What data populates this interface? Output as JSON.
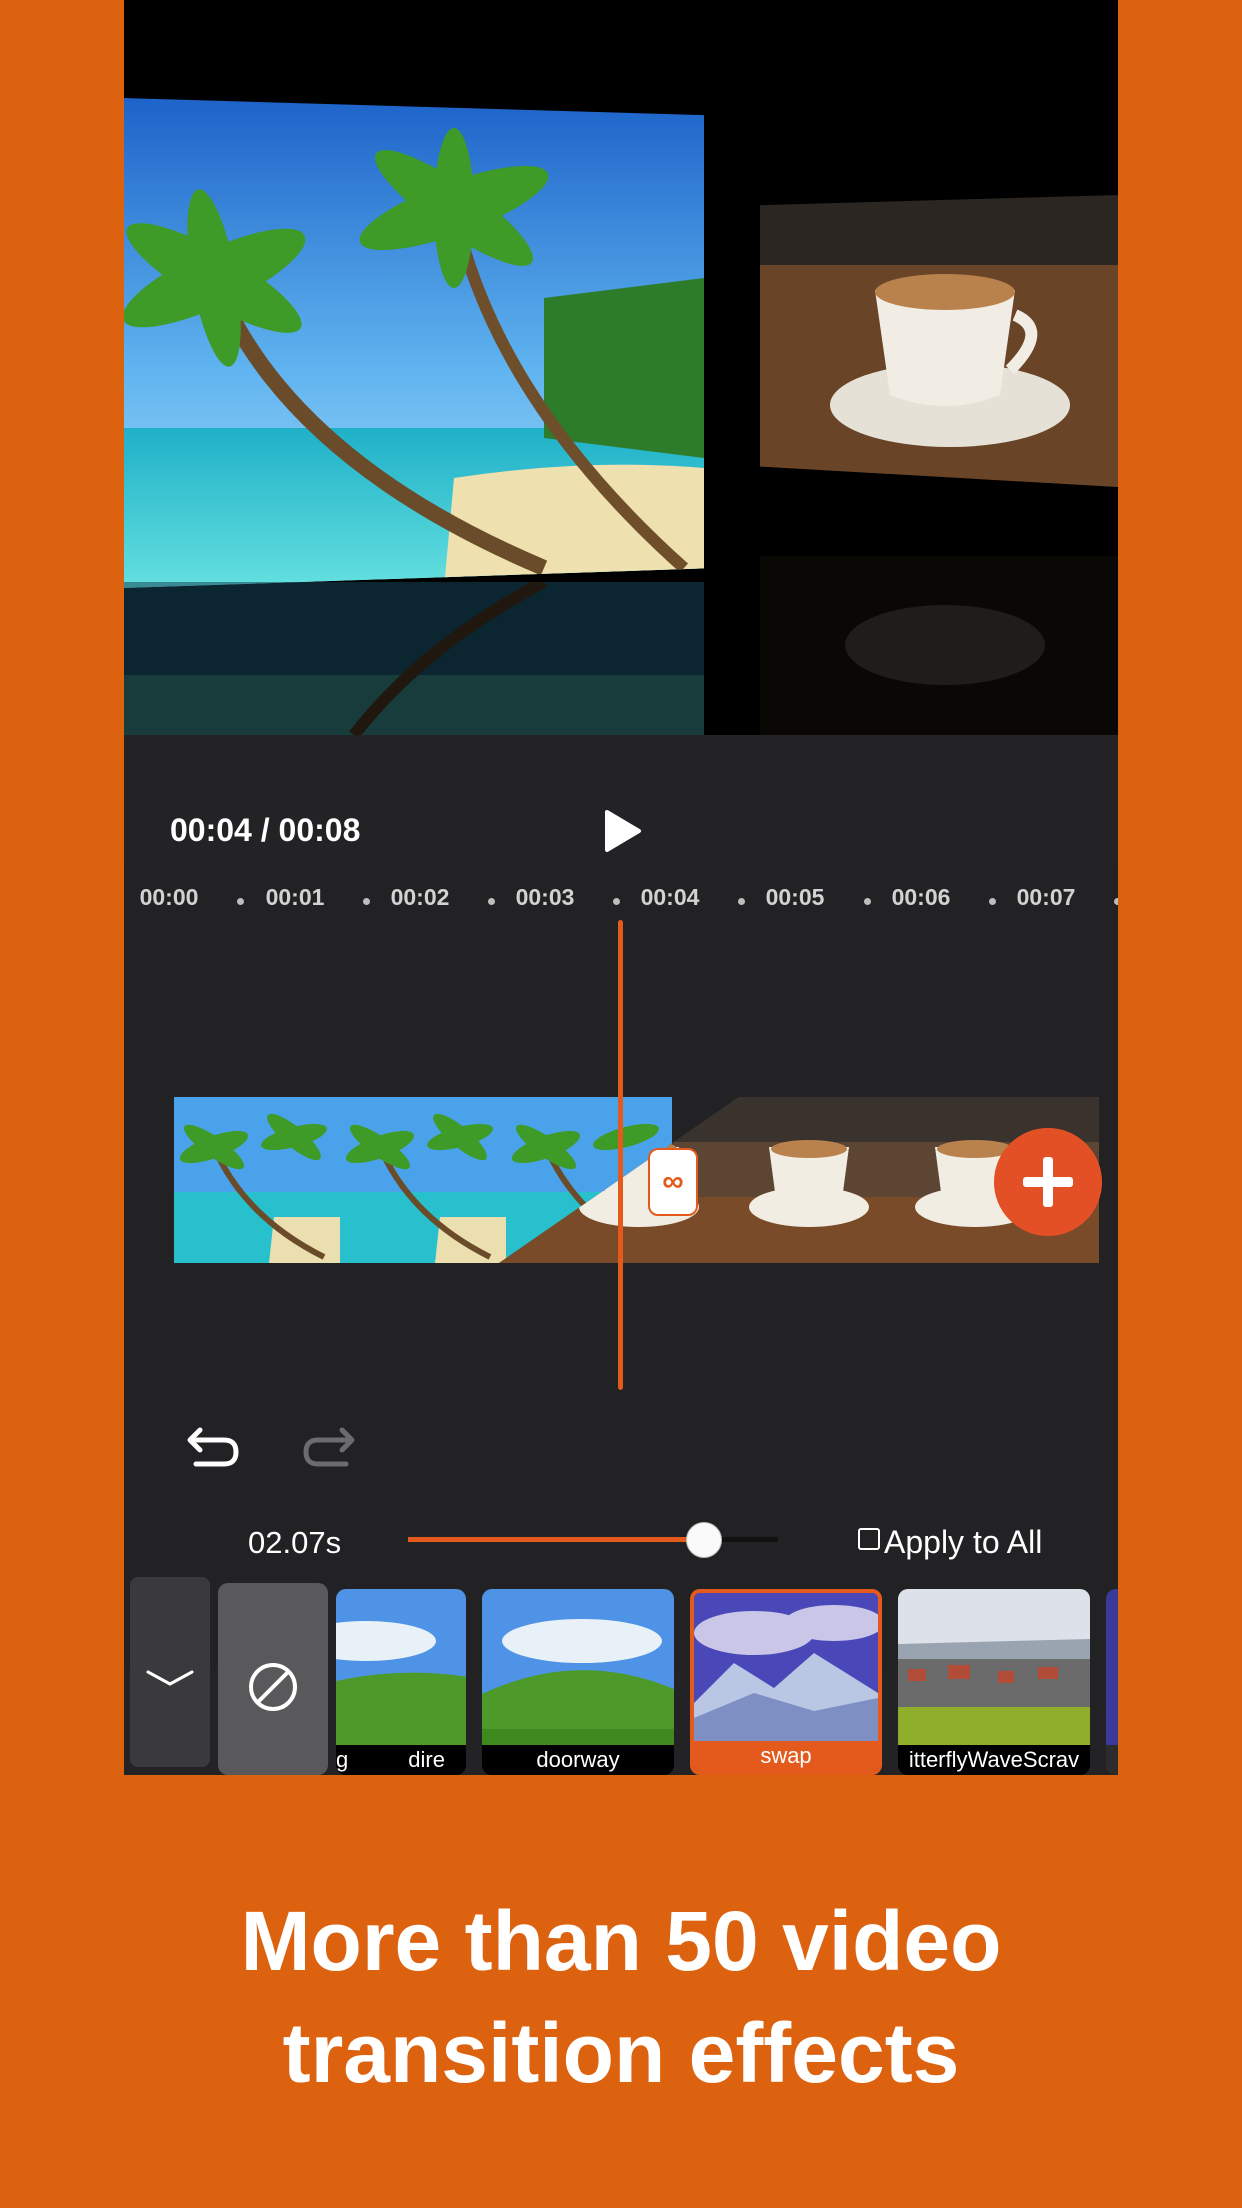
{
  "player": {
    "current_time": "00:04",
    "total_time": "00:08",
    "time_readout": "00:04 / 00:08"
  },
  "timeline": {
    "ticks": [
      "00:00",
      "00:01",
      "00:02",
      "00:03",
      "00:04",
      "00:05",
      "00:06",
      "00:07"
    ]
  },
  "transition": {
    "duration_label": "02.07s",
    "slider_fraction": 0.8,
    "apply_all_label": "Apply to All",
    "apply_all_checked": false
  },
  "effects": [
    {
      "label": "g",
      "partial": true
    },
    {
      "label": "dire",
      "partial": true
    },
    {
      "label": "doorway"
    },
    {
      "label": "swap",
      "selected": true
    },
    {
      "label": "itterflyWaveScrav",
      "partial": true
    }
  ],
  "caption": {
    "line1": "More than 50 video",
    "line2": "transition effects"
  },
  "colors": {
    "background": "#dc620f",
    "accent": "#e35a1c",
    "panel": "#232325"
  },
  "icons": [
    "play-icon",
    "undo-icon",
    "redo-icon",
    "plus-icon",
    "chevron-down-icon",
    "none-icon",
    "infinity-icon"
  ]
}
